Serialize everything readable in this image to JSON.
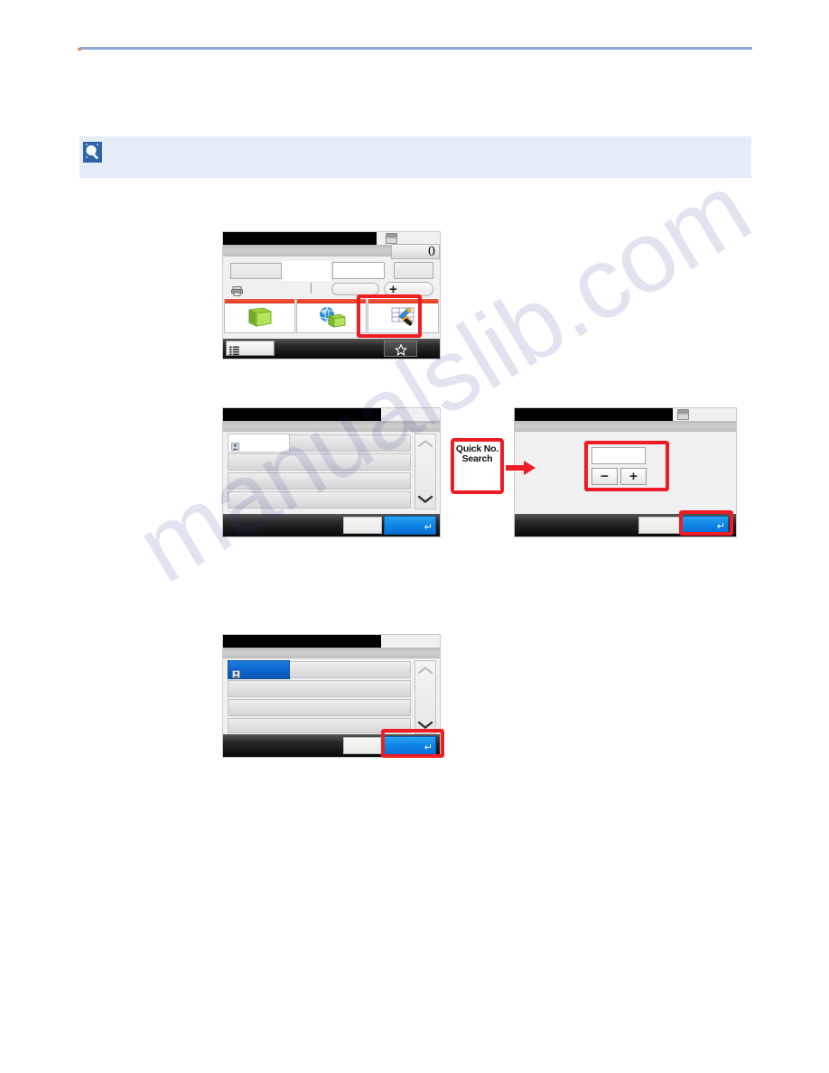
{
  "document": {
    "type": "printer-operation-manual-page",
    "watermark": "manualslib.com",
    "header_rule_color": "#8aa9d6",
    "note": {
      "icon": "note-magnifier-icon",
      "background": "#e6ecf8",
      "text": ""
    }
  },
  "panels": [
    {
      "id": "panel-home-destination",
      "name": "destination-entry-screen",
      "title": "",
      "counter": "0",
      "status_icon": "printer-status-icon",
      "fields": [
        {
          "name": "destination-field-1",
          "value": ""
        },
        {
          "name": "destination-field-2",
          "value": ""
        },
        {
          "name": "destination-field-3",
          "value": ""
        }
      ],
      "toolbar": {
        "printer_icon": "printer-icon",
        "pill_label": "",
        "add_button_label": "+"
      },
      "tabs": [
        {
          "name": "tab-address-book",
          "icon": "green-folder-icon",
          "label": ""
        },
        {
          "name": "tab-ext-address-book",
          "icon": "globe-folder-icon",
          "label": ""
        },
        {
          "name": "tab-address-entry",
          "icon": "spreadsheet-pen-icon",
          "label": ""
        }
      ],
      "bottom": {
        "menu_button_label": "",
        "menu_icon": "list-menu-icon",
        "favorite_icon": "star-icon"
      },
      "highlight": "tab-address-entry"
    },
    {
      "id": "panel-address-list",
      "name": "address-book-list-screen",
      "title": "",
      "rows": [
        {
          "name": "list-row-1",
          "label": "",
          "icon": "contact-icon",
          "state": "normal"
        },
        {
          "name": "list-row-2",
          "label": "",
          "state": "normal"
        },
        {
          "name": "list-row-3",
          "label": "",
          "state": "normal"
        },
        {
          "name": "list-row-4",
          "label": "",
          "state": "normal"
        }
      ],
      "scroll": {
        "up_icon": "chevron-up-icon",
        "down_icon": "chevron-down-icon"
      },
      "footer": {
        "cancel_label": "",
        "ok_label": "",
        "ok_icon": "enter-arrow-icon"
      }
    },
    {
      "id": "panel-quick-number",
      "name": "quick-number-entry-screen",
      "title": "",
      "status_icon": "printer-status-icon",
      "number_field": {
        "name": "quick-number-input",
        "value": ""
      },
      "minus_button_label": "−",
      "plus_button_label": "+",
      "footer": {
        "cancel_label": "",
        "ok_label": "",
        "ok_icon": "enter-arrow-icon"
      },
      "highlights": [
        "number-entry-group",
        "ok-button"
      ]
    },
    {
      "id": "panel-address-list-selected",
      "name": "address-book-list-selected-screen",
      "title": "",
      "rows": [
        {
          "name": "list-row-1",
          "label": "",
          "icon": "contact-icon",
          "state": "selected"
        },
        {
          "name": "list-row-2",
          "label": "",
          "state": "normal"
        },
        {
          "name": "list-row-3",
          "label": "",
          "state": "normal"
        },
        {
          "name": "list-row-4",
          "label": "",
          "state": "normal"
        }
      ],
      "scroll": {
        "up_icon": "chevron-up-icon",
        "down_icon": "chevron-down-icon"
      },
      "footer": {
        "cancel_label": "",
        "ok_label": "",
        "ok_icon": "enter-arrow-icon"
      },
      "highlights": [
        "ok-button"
      ]
    }
  ],
  "callout": {
    "name": "quick-no-search-callout",
    "line1": "Quick No.",
    "line2": "Search",
    "icon": "numeric-keypad-icon",
    "arrow": "red-right-arrow",
    "border_color": "#ee1c25"
  },
  "colors": {
    "highlight_red": "#ee1c25",
    "ok_blue": "#0f86e8",
    "selected_blue": "#0b63c9",
    "tab_orange": "#e03b22",
    "rule_blue": "#8aa9d6",
    "note_bg": "#e6ecf8"
  }
}
